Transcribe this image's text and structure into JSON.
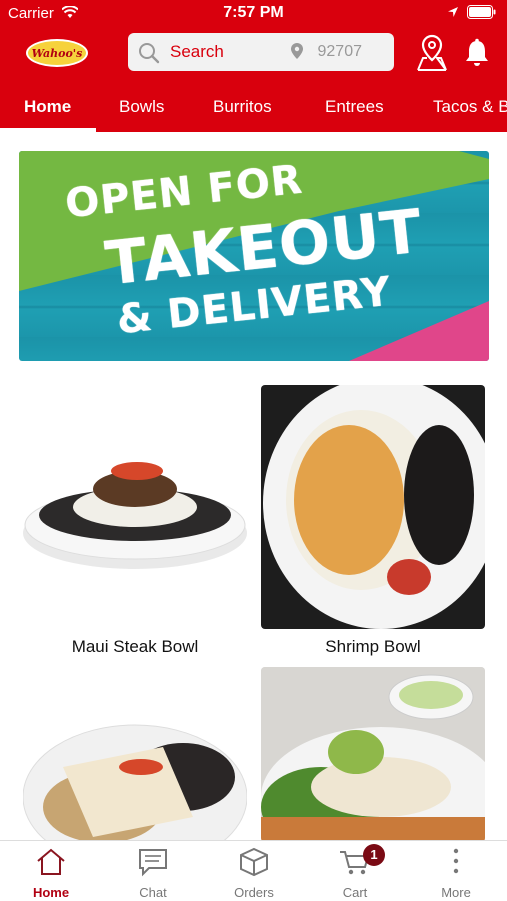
{
  "status_bar": {
    "carrier": "Carrier",
    "time": "7:57 PM"
  },
  "header": {
    "logo_text": "Wahoo's",
    "search_placeholder": "Search",
    "zip": "92707",
    "location_icon": "map-pin-icon",
    "bell_icon": "bell-icon"
  },
  "tabs": [
    {
      "label": "Home",
      "active": true
    },
    {
      "label": "Bowls",
      "active": false
    },
    {
      "label": "Burritos",
      "active": false
    },
    {
      "label": "Entrees",
      "active": false
    },
    {
      "label": "Tacos & B",
      "active": false
    }
  ],
  "banner": {
    "line1": "OPEN FOR",
    "line2": "TAKEOUT",
    "line3": "& DELIVERY"
  },
  "items": [
    {
      "label": "Maui Steak Bowl"
    },
    {
      "label": "Shrimp Bowl"
    },
    {
      "label": ""
    },
    {
      "label": ""
    }
  ],
  "tabbar": [
    {
      "label": "Home",
      "icon": "home-icon",
      "active": true
    },
    {
      "label": "Chat",
      "icon": "chat-icon",
      "active": false
    },
    {
      "label": "Orders",
      "icon": "box-icon",
      "active": false
    },
    {
      "label": "Cart",
      "icon": "cart-icon",
      "active": false
    },
    {
      "label": "More",
      "icon": "more-icon",
      "active": false
    }
  ],
  "cart_count": "1",
  "colors": {
    "brand_red": "#d9000d",
    "badge": "#7a0a14",
    "teal": "#1f9fb3"
  }
}
